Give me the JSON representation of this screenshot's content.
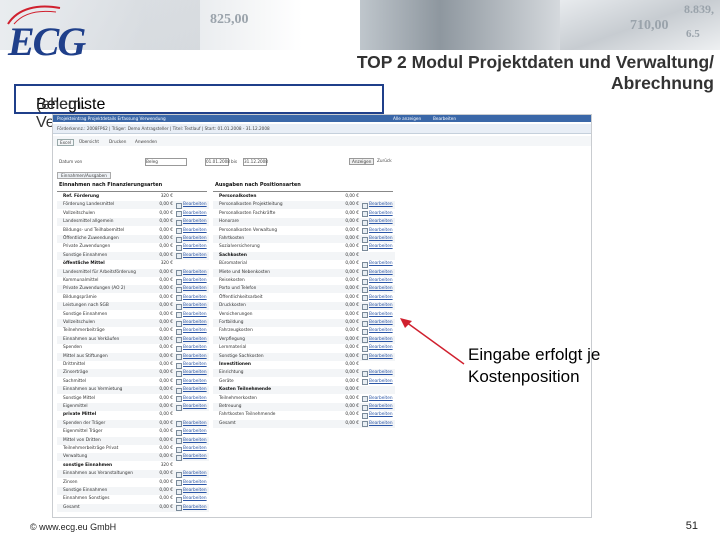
{
  "header": {
    "logo_text": "ECG",
    "banner_numbers": [
      "825,00",
      "710,00",
      "8.839,",
      "6.5"
    ],
    "title_line1": "TOP 2 Modul Projektdaten und Verwaltung/",
    "title_line2": "Abrechnung",
    "subtitle_main": "Belegliste",
    "subtitle_paren": "(ehem. Verwendungsnachweis)"
  },
  "app": {
    "toolbar_top": "Projekteintrag     Projektdetails     Erfassung     Verwendung",
    "status_links": [
      "Alle anzeigen",
      "Bearbeiten"
    ],
    "info_bar": "Förderkennz.: 2008FP62  |  Träger: Demo Antragsteller  |  Titel: Testlauf  |  Start: 01.01.2008 - 31.12.2008",
    "toolbar_buttons": [
      "Excel",
      "Übersicht",
      "Drucken",
      "Anwenden"
    ],
    "filter_label_from": "Datum von",
    "filter_value_from": "01.01.2008",
    "filter_label_to": "bis",
    "filter_value_to": "31.12.2008",
    "filter_select": "Beleg",
    "filter_button": "Anzeigen",
    "filter_reset": "Zurück",
    "tab_label": "Einnahmen/Ausgaben",
    "left_header": "Einnahmen nach Finanzierungsarten",
    "right_header": "Ausgaben nach Positionsarten",
    "left_rows": [
      {
        "label": "Ref. Förderung",
        "value": "320 €",
        "section": true
      },
      {
        "label": "Förderung Landesmittel",
        "value": "0,00 €"
      },
      {
        "label": "Vollzeitschulen",
        "value": "0,00 €"
      },
      {
        "label": "Landesmittel allgemein",
        "value": "0,00 €"
      },
      {
        "label": "Bildungs- und Teilhabemittel",
        "value": "0,00 €"
      },
      {
        "label": "Öffentliche Zuwendungen",
        "value": "0,00 €"
      },
      {
        "label": "Private Zuwendungen",
        "value": "0,00 €"
      },
      {
        "label": "Sonstige Einnahmen",
        "value": "0,00 €"
      },
      {
        "label": "öffentliche Mittel",
        "value": "320 €",
        "section": true
      },
      {
        "label": "Landesmittel für Arbeitsförderung",
        "value": "0,00 €"
      },
      {
        "label": "Kommunalmittel",
        "value": "0,00 €"
      },
      {
        "label": "Private Zuwendungen (AO 2)",
        "value": "0,00 €"
      },
      {
        "label": "Bildungsprämie",
        "value": "0,00 €"
      },
      {
        "label": "Leistungen nach SGB",
        "value": "0,00 €"
      },
      {
        "label": "Sonstige Einnahmen",
        "value": "0,00 €"
      },
      {
        "label": "Vollzeitschulen",
        "value": "0,00 €"
      },
      {
        "label": "Teilnehmerbeiträge",
        "value": "0,00 €"
      },
      {
        "label": "Einnahmen aus Verkäufen",
        "value": "0,00 €"
      },
      {
        "label": "Spenden",
        "value": "0,00 €"
      },
      {
        "label": "Mittel aus Stiftungen",
        "value": "0,00 €"
      },
      {
        "label": "Drittmittel",
        "value": "0,00 €"
      },
      {
        "label": "Zinserträge",
        "value": "0,00 €"
      },
      {
        "label": "Sachmittel",
        "value": "0,00 €"
      },
      {
        "label": "Einnahmen aus Vermietung",
        "value": "0,00 €"
      },
      {
        "label": "Sonstige Mittel",
        "value": "0,00 €"
      },
      {
        "label": "Eigenmittel",
        "value": "0,00 €"
      },
      {
        "label": "private Mittel",
        "value": "0,00 €",
        "section": true
      },
      {
        "label": "Spenden der Träger",
        "value": "0,00 €"
      },
      {
        "label": "Eigenmittel Träger",
        "value": "0,00 €"
      },
      {
        "label": "Mittel von Dritten",
        "value": "0,00 €"
      },
      {
        "label": "Teilnehmerbeiträge Privat",
        "value": "0,00 €"
      },
      {
        "label": "Verwaltung",
        "value": "0,00 €"
      },
      {
        "label": "sonstige Einnahmen",
        "value": "320 €",
        "section": true
      },
      {
        "label": "Einnahmen aus Veranstaltungen",
        "value": "0,00 €"
      },
      {
        "label": "Zinsen",
        "value": "0,00 €"
      },
      {
        "label": "Sonstige Einnahmen",
        "value": "0,00 €"
      },
      {
        "label": "Einnahmen Sonstiges",
        "value": "0,00 €"
      },
      {
        "label": "Gesamt",
        "value": "0,00 €"
      }
    ],
    "right_rows": [
      {
        "label": "Personalkosten",
        "value": "0,00 €",
        "section": true
      },
      {
        "label": "Personalkosten Projektleitung",
        "value": "0,00 €"
      },
      {
        "label": "Personalkosten Fachkräfte",
        "value": "0,00 €"
      },
      {
        "label": "Honorare",
        "value": "0,00 €"
      },
      {
        "label": "Personalkosten Verwaltung",
        "value": "0,00 €"
      },
      {
        "label": "Fahrtkosten",
        "value": "0,00 €"
      },
      {
        "label": "Sozialversicherung",
        "value": "0,00 €"
      },
      {
        "label": "Sachkosten",
        "value": "0,00 €",
        "section": true
      },
      {
        "label": "Büromaterial",
        "value": "0,00 €"
      },
      {
        "label": "Miete und Nebenkosten",
        "value": "0,00 €"
      },
      {
        "label": "Reisekosten",
        "value": "0,00 €"
      },
      {
        "label": "Porto und Telefon",
        "value": "0,00 €"
      },
      {
        "label": "Öffentlichkeitsarbeit",
        "value": "0,00 €"
      },
      {
        "label": "Druckkosten",
        "value": "0,00 €"
      },
      {
        "label": "Versicherungen",
        "value": "0,00 €"
      },
      {
        "label": "Fortbildung",
        "value": "0,00 €"
      },
      {
        "label": "Fahrzeugkosten",
        "value": "0,00 €"
      },
      {
        "label": "Verpflegung",
        "value": "0,00 €"
      },
      {
        "label": "Lernmaterial",
        "value": "0,00 €"
      },
      {
        "label": "Sonstige Sachkosten",
        "value": "0,00 €"
      },
      {
        "label": "Investitionen",
        "value": "0,00 €",
        "section": true
      },
      {
        "label": "Einrichtung",
        "value": "0,00 €"
      },
      {
        "label": "Geräte",
        "value": "0,00 €"
      },
      {
        "label": "Kosten Teilnehmende",
        "value": "0,00 €",
        "section": true
      },
      {
        "label": "Teilnehmerkosten",
        "value": "0,00 €"
      },
      {
        "label": "Betreuung",
        "value": "0,00 €"
      },
      {
        "label": "Fahrtkosten Teilnehmende",
        "value": "0,00 €"
      },
      {
        "label": "Gesamt",
        "value": "0,00 €"
      }
    ],
    "row_link": "Bearbeiten"
  },
  "callout": {
    "line1": "Eingabe erfolgt je",
    "line2": "Kostenposition"
  },
  "footer": {
    "copyright": "© www.ecg.eu GmbH",
    "page_number": "51"
  }
}
